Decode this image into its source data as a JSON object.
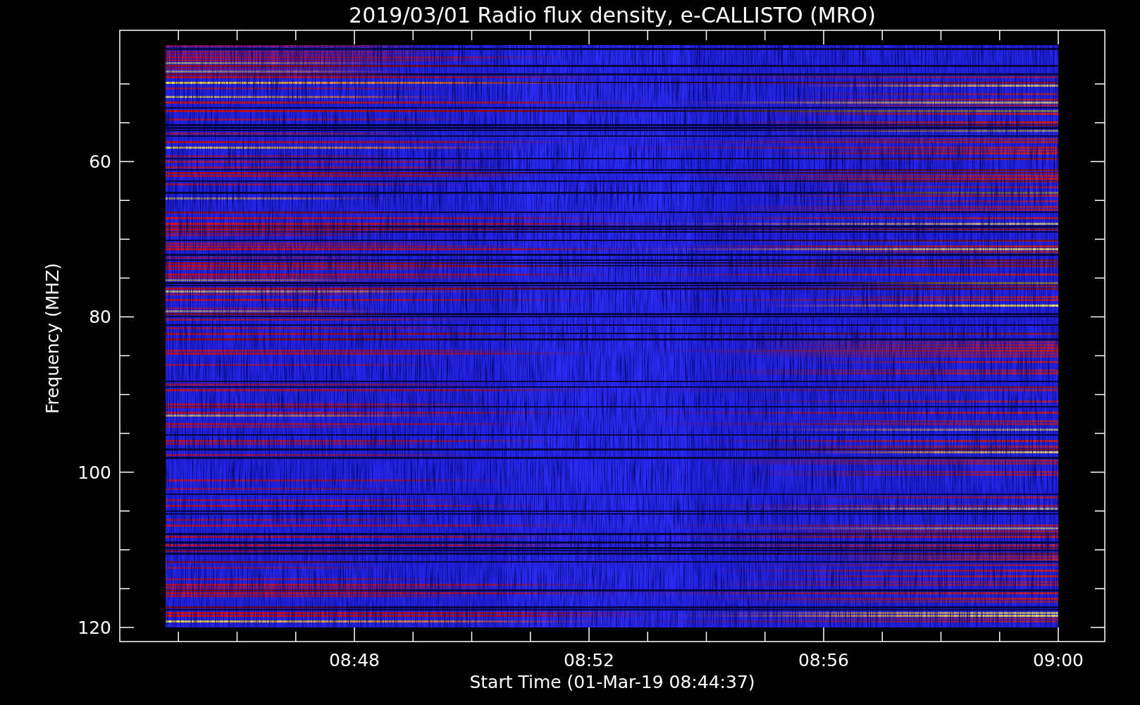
{
  "title": "2019/03/01  Radio flux density, e-CALLISTO (MRO)",
  "plot": {
    "ylabel": "Frequency (MHZ)",
    "xlabel": "Start Time (01-Mar-19 08:44:37)",
    "yticks": [
      "60",
      "80",
      "100",
      "120"
    ],
    "xticks": [
      "08:48",
      "08:52",
      "08:56",
      "09:00"
    ]
  }
}
